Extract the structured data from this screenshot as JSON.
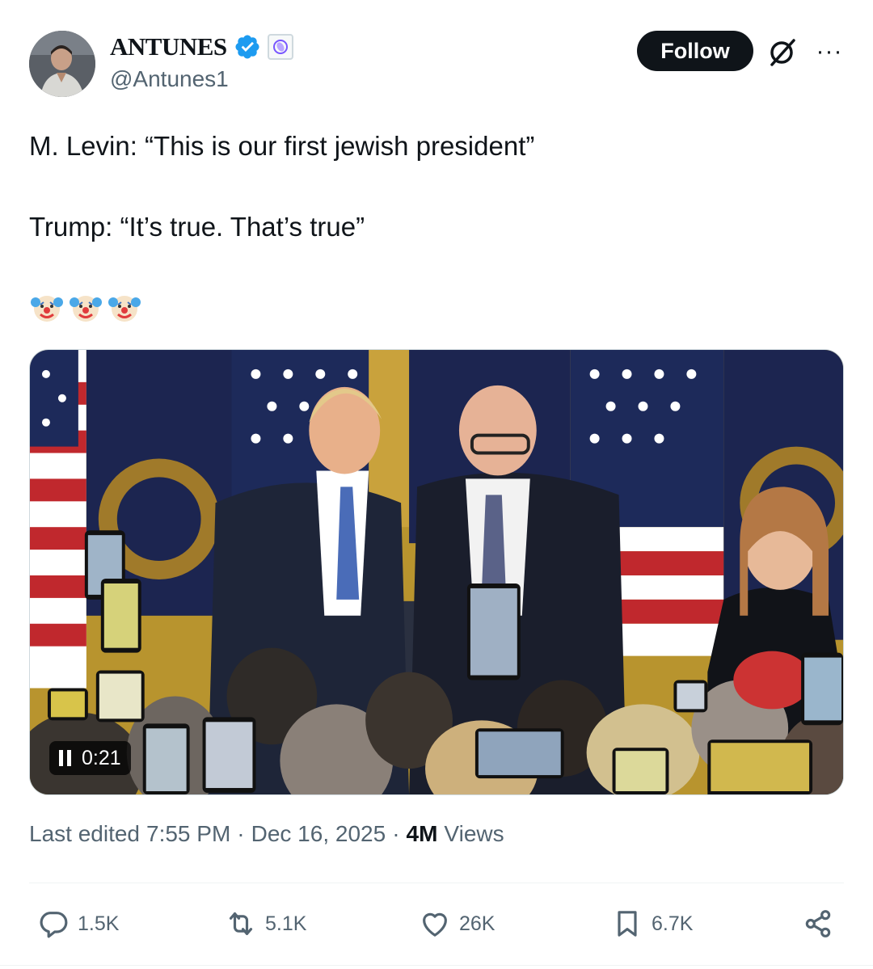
{
  "author": {
    "display_name": "ANTUNES",
    "handle": "@Antunes1"
  },
  "header": {
    "follow_label": "Follow",
    "more_label": "···"
  },
  "tweet": {
    "line1": "M. Levin: “This is our first jewish president”",
    "line2": "Trump: “It’s true. That’s true”",
    "emojis": [
      "clown-face",
      "clown-face",
      "clown-face"
    ]
  },
  "media": {
    "duration": "0:21",
    "state": "playing"
  },
  "meta": {
    "edited_prefix": "Last edited",
    "time": "7:55 PM",
    "separator": "·",
    "date": "Dec 16, 2025",
    "views_count": "4M",
    "views_label": "Views"
  },
  "actions": {
    "replies": "1.5K",
    "reposts": "5.1K",
    "likes": "26K",
    "bookmarks": "6.7K"
  },
  "colors": {
    "verified": "#1d9bf0",
    "text_primary": "#0f1419",
    "text_secondary": "#536471",
    "follow_bg": "#0f1419"
  }
}
